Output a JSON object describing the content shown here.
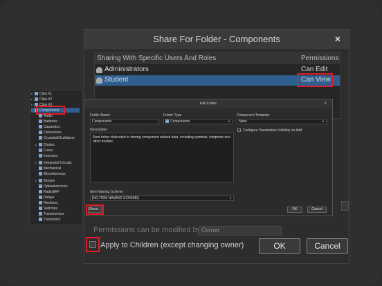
{
  "colors": {
    "accent": "#e21d2a",
    "selection": "#2f5f8f"
  },
  "share_dialog": {
    "title": "Share For Folder - Components",
    "close_icon": "×",
    "table": {
      "col_users": "Sharing With Specific Users And Roles",
      "col_permissions": "Permissions",
      "rows": [
        {
          "name": "Administrators",
          "permission": "Can Edit"
        },
        {
          "name": "Student",
          "permission": "Can View"
        }
      ]
    },
    "permissions_note": "Permissions can be modified by",
    "owner_value": "Owner",
    "apply_children_label": "Apply to Children (except changing owner)",
    "ok_label": "OK",
    "cancel_label": "Cancel"
  },
  "tree": {
    "items": [
      {
        "label": "Clips #1"
      },
      {
        "label": "Clips #2"
      },
      {
        "label": "Clips #3"
      },
      {
        "label": "Components"
      },
      {
        "label": "Audio"
      },
      {
        "label": "Batteries"
      },
      {
        "label": "Capacitors"
      },
      {
        "label": "Connectors"
      },
      {
        "label": "Crystals&Oscillators"
      },
      {
        "label": "Diodes"
      },
      {
        "label": "Fuses"
      },
      {
        "label": "Inductors"
      },
      {
        "label": "Integrated Circuits"
      },
      {
        "label": "Mechanical"
      },
      {
        "label": "Miscellaneous"
      },
      {
        "label": "Models"
      },
      {
        "label": "Optoelectronics"
      },
      {
        "label": "Radio&RF"
      },
      {
        "label": "Relays"
      },
      {
        "label": "Resistors"
      },
      {
        "label": "Switches"
      },
      {
        "label": "Transformers"
      },
      {
        "label": "Transistors"
      }
    ]
  },
  "edit_dialog": {
    "title": "Edit Folder",
    "close_icon": "×",
    "folder_name_label": "Folder Name",
    "folder_name_value": "Components",
    "folder_type_label": "Folder Type",
    "folder_type_value": "Components",
    "component_template_label": "Component Template",
    "component_template_value": "None",
    "configure_params_label": "Configure Parameters Visibility on Add",
    "description_label": "Description",
    "description_value": "Root folder dedicated to storing component related data, including symbols, footprints and other models",
    "item_naming_label": "Item Naming Scheme",
    "item_naming_value": "[NO ITEM NAMING SCHEME]",
    "share_label": "Share...",
    "ok_label": "OK",
    "cancel_label": "Cancel"
  }
}
